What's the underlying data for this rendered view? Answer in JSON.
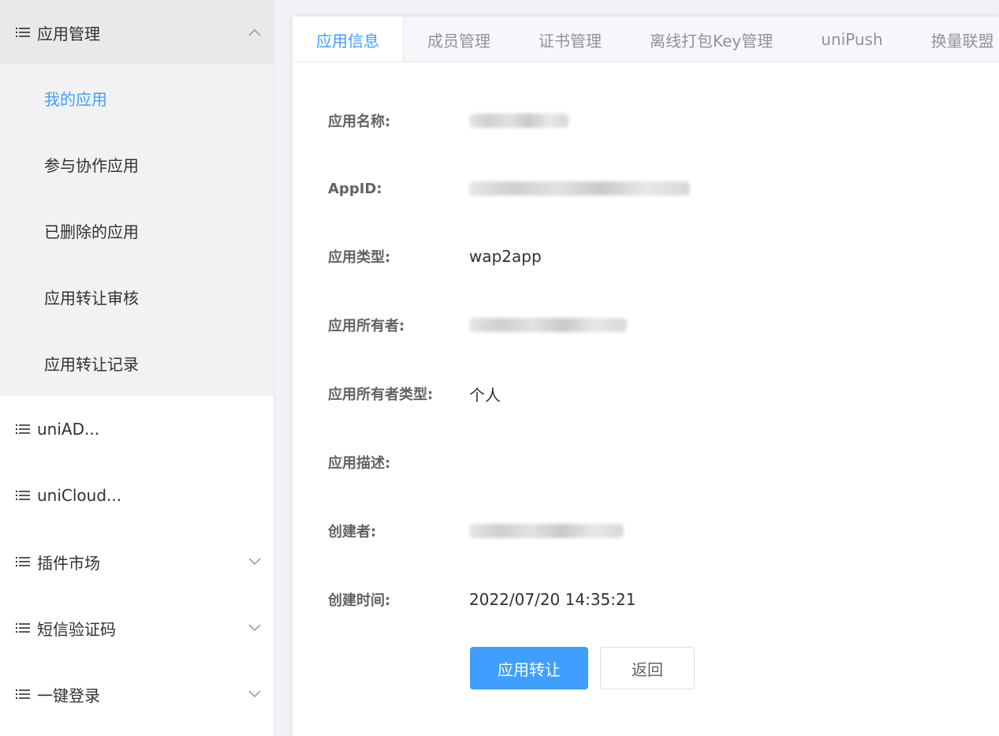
{
  "colors": {
    "accent": "#409eff",
    "sidebar_open_bg": "#e9e9e9",
    "submenu_bg": "#f2f2f2"
  },
  "sidebar": {
    "groups": [
      {
        "label": "应用管理",
        "icon": "list-icon",
        "expanded": true,
        "items": [
          {
            "label": "我的应用",
            "active": true
          },
          {
            "label": "参与协作应用"
          },
          {
            "label": "已删除的应用"
          },
          {
            "label": "应用转让审核"
          },
          {
            "label": "应用转让记录"
          }
        ]
      },
      {
        "label": "uniAD...",
        "icon": "list-icon"
      },
      {
        "label": "uniCloud...",
        "icon": "list-icon"
      },
      {
        "label": "插件市场",
        "icon": "list-icon",
        "arrow": "chevron-down-icon"
      },
      {
        "label": "短信验证码",
        "icon": "list-icon",
        "arrow": "chevron-down-icon"
      },
      {
        "label": "一键登录",
        "icon": "list-icon",
        "arrow": "chevron-down-icon"
      }
    ]
  },
  "tabs": [
    {
      "label": "应用信息",
      "active": true
    },
    {
      "label": "成员管理"
    },
    {
      "label": "证书管理"
    },
    {
      "label": "离线打包Key管理"
    },
    {
      "label": "uniPush"
    },
    {
      "label": "换量联盟"
    }
  ],
  "info": {
    "app_name": {
      "label": "应用名称:",
      "value_redacted": true
    },
    "appid": {
      "label": "AppID:",
      "value_redacted": true
    },
    "app_type": {
      "label": "应用类型:",
      "value": "wap2app"
    },
    "owner": {
      "label": "应用所有者:",
      "value_redacted": true
    },
    "owner_type": {
      "label": "应用所有者类型:",
      "value": "个人"
    },
    "desc": {
      "label": "应用描述:",
      "value": ""
    },
    "creator": {
      "label": "创建者:",
      "value_redacted": true
    },
    "created_at": {
      "label": "创建时间:",
      "value": "2022/07/20 14:35:21"
    }
  },
  "buttons": {
    "transfer": "应用转让",
    "back": "返回"
  }
}
